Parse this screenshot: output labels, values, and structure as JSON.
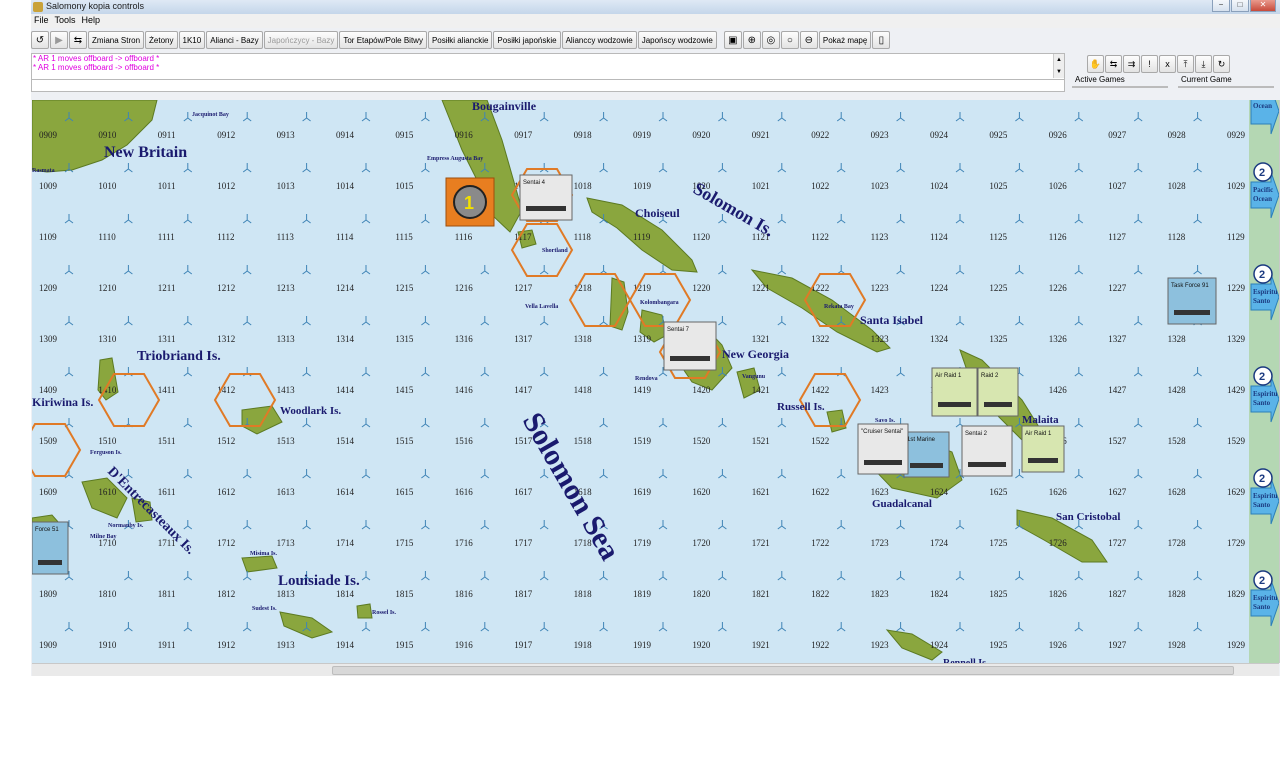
{
  "window": {
    "title": "Salomony kopia controls",
    "menu": [
      "File",
      "Tools",
      "Help"
    ],
    "buttons": [
      "−",
      "□",
      "✕"
    ]
  },
  "toolbar": {
    "left_icons": [
      "undo-icon",
      "step-icon",
      "swap-icon"
    ],
    "buttons": [
      {
        "label": "Zmiana Stron",
        "enabled": true
      },
      {
        "label": "Żetony",
        "enabled": true
      },
      {
        "label": "1K10",
        "enabled": true
      },
      {
        "label": "Alianci - Bazy",
        "enabled": true
      },
      {
        "label": "Japończycy - Bazy",
        "enabled": false
      },
      {
        "label": "Tor Etapów/Pole Bitwy",
        "enabled": true
      },
      {
        "label": "Posiłki alianckie",
        "enabled": true
      },
      {
        "label": "Posiłki japońskie",
        "enabled": true
      },
      {
        "label": "Alianccy wodzowie",
        "enabled": true
      },
      {
        "label": "Japońscy wodzowie",
        "enabled": true
      }
    ],
    "right_icons": [
      "camera-icon",
      "zoom-in-icon",
      "zoom-select-icon",
      "zoom-icon",
      "zoom-out-icon"
    ],
    "show_map": "Pokaż mapę",
    "device_icon": "device-icon"
  },
  "log": {
    "lines": [
      "* AR 1 moves offboard -> offboard *",
      "* AR 1 moves offboard -> offboard *"
    ]
  },
  "right_tools": [
    "hand-icon",
    "arrows-icon",
    "split-icon",
    "alert-icon",
    "delete-icon",
    "stack-up-icon",
    "stack-down-icon",
    "refresh-icon"
  ],
  "right_tool_glyphs": [
    "✋",
    "⇆",
    "⇉",
    "!",
    "x",
    "⤒",
    "⤓",
    "↻"
  ],
  "game_tabs": [
    "Active Games",
    "Current Game"
  ],
  "map": {
    "region_labels": [
      "New Britain",
      "Bougainville",
      "Choiseul",
      "Solomon Is.",
      "Santa Isabel",
      "New Georgia",
      "Triobriand Is.",
      "Kiriwina Is.",
      "Woodlark Is.",
      "Russell Is.",
      "Solomon Sea",
      "D'Entrecasteaux Is.",
      "Louisiade Is.",
      "Guadalcanal",
      "San Cristobal",
      "Rennell Is.",
      "Malaita"
    ],
    "small_labels": [
      "Jacquinot Bay",
      "Rasmata",
      "Empress Augusta Bay",
      "Shortland",
      "Vella Lavella",
      "Kolombangara",
      "Rendova",
      "Vangunu",
      "Rekata Bay",
      "Savo Is.",
      "Ferguson Is.",
      "Normanby Is.",
      "Milne Bay",
      "Misima Is.",
      "Sudest Is.",
      "Rossel Is."
    ],
    "counters": [
      "Sentai 4",
      "Sentai 7",
      "Sentai 2",
      "Air Raid 1",
      "Raid 2",
      "Air Raid 1",
      "Task Force 91",
      "1st Marine",
      "\"Cruiser Sentai\"",
      "Force 51"
    ],
    "turn_marker": "1",
    "rail": [
      {
        "name": "Ocean",
        "num": ""
      },
      {
        "name": "Pacific Ocean",
        "num": "2"
      },
      {
        "name": "Espiritu Santo",
        "num": "2"
      },
      {
        "name": "Espiritu Santo",
        "num": "2"
      },
      {
        "name": "Espiritu Santo",
        "num": "2"
      },
      {
        "name": "Espiritu Santo",
        "num": "2"
      }
    ],
    "colors": {
      "sea": "#cfe6f4",
      "land": "#8aa63e",
      "hex_outline": "#e07a26",
      "label": "#1a1a6e",
      "rail": "#b4d7b3"
    }
  }
}
